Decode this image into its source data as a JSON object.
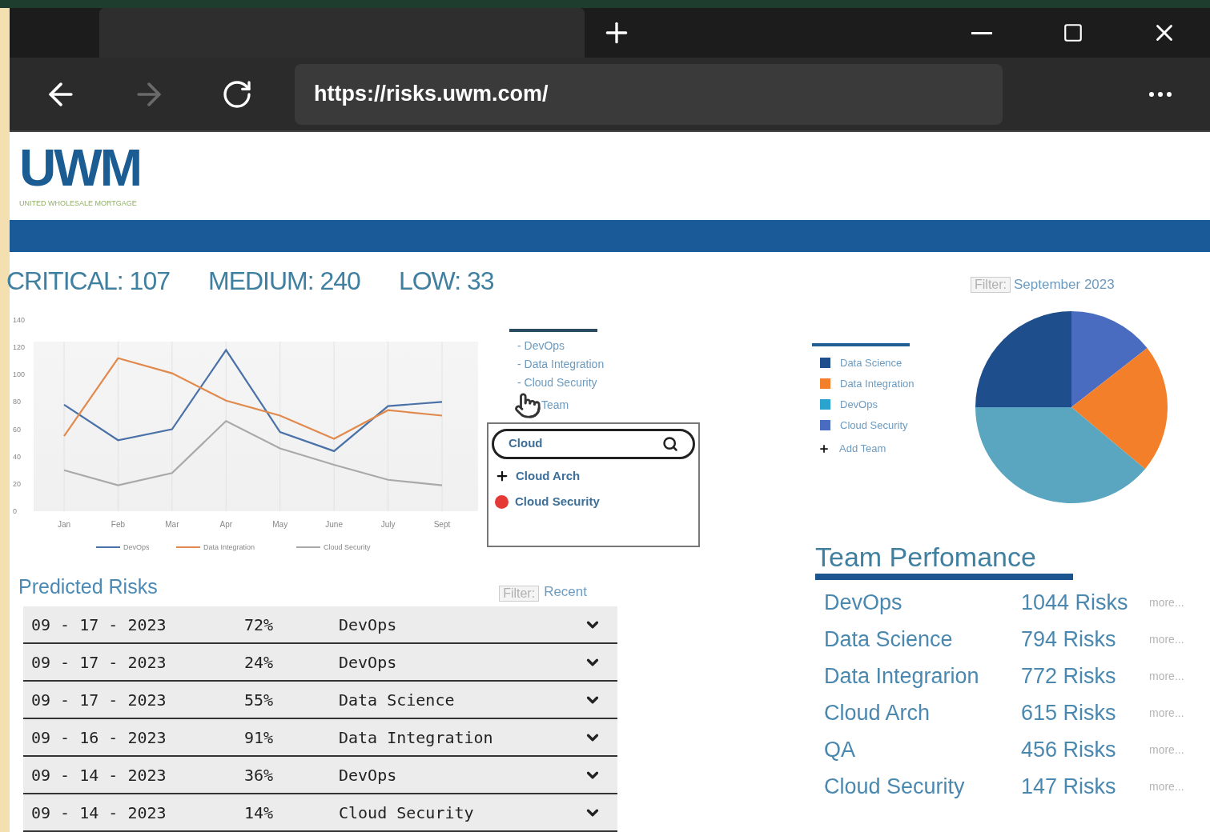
{
  "browser": {
    "url": "https://risks.uwm.com/",
    "back_disabled": false,
    "forward_disabled": true
  },
  "logo": {
    "mark": "UWM",
    "tagline": "UNITED WHOLESALE MORTGAGE"
  },
  "stats": [
    {
      "label": "CRITICAL: 107"
    },
    {
      "label": "MEDIUM: 240"
    },
    {
      "label": "LOW: 33"
    }
  ],
  "trend_chart": {
    "chart_data": {
      "type": "line",
      "grid": true,
      "legend": "bottom",
      "categories": [
        "Jan",
        "Feb",
        "Mar",
        "Apr",
        "May",
        "June",
        "July",
        "Sept"
      ],
      "ylim": [
        0,
        140
      ],
      "yticks": [
        0,
        20,
        40,
        60,
        80,
        100,
        120,
        140
      ],
      "series": [
        {
          "name": "DevOps",
          "color": "#4a72a8",
          "values": [
            78,
            52,
            60,
            118,
            58,
            44,
            77,
            80
          ]
        },
        {
          "name": "Data Integration",
          "color": "#e08a4e",
          "values": [
            55,
            112,
            101,
            81,
            70,
            53,
            74,
            70
          ]
        },
        {
          "name": "Cloud Security",
          "color": "#a9a9a9",
          "values": [
            30,
            19,
            28,
            66,
            46,
            34,
            23,
            19
          ]
        }
      ]
    }
  },
  "team_list": {
    "items": [
      "- DevOps",
      "- Data Integration",
      "- Cloud Security"
    ],
    "partial_item": "Team"
  },
  "team_search": {
    "value": "Cloud",
    "results": [
      {
        "kind": "add",
        "label": "Cloud Arch"
      },
      {
        "kind": "remove",
        "label": "Cloud Security"
      }
    ]
  },
  "pie_filter": {
    "button": "Filter:",
    "value": "September 2023"
  },
  "pie_legend": [
    {
      "label": "Data Science",
      "color": "#1f4e8c"
    },
    {
      "label": "Data Integration",
      "color": "#f47f2a"
    },
    {
      "label": "DevOps",
      "color": "#2aa3cf"
    },
    {
      "label": "Cloud Security",
      "color": "#4a6cc0"
    }
  ],
  "pie_add": "Add Team",
  "predicted_risks": {
    "title": "Predicted Risks",
    "filter_button": "Filter:",
    "filter_value": "Recent",
    "rows": [
      {
        "date": "09 - 17 - 2023",
        "percent": "72%",
        "team": "DevOps"
      },
      {
        "date": "09 - 17 - 2023",
        "percent": "24%",
        "team": "DevOps"
      },
      {
        "date": "09 - 17 - 2023",
        "percent": "55%",
        "team": "Data Science"
      },
      {
        "date": "09 - 16 - 2023",
        "percent": "91%",
        "team": "Data Integration"
      },
      {
        "date": "09 - 14 - 2023",
        "percent": "36%",
        "team": "DevOps"
      },
      {
        "date": "09 - 14 - 2023",
        "percent": "14%",
        "team": "Cloud Security"
      }
    ]
  },
  "team_performance": {
    "title": "Team Perfomance",
    "rows": [
      {
        "team": "DevOps",
        "risks": "1044 Risks",
        "link": "more..."
      },
      {
        "team": "Data Science",
        "risks": "794 Risks",
        "link": "more..."
      },
      {
        "team": "Data Integrarion",
        "risks": "772 Risks",
        "link": "more..."
      },
      {
        "team": "Cloud Arch",
        "risks": "615 Risks",
        "link": "more..."
      },
      {
        "team": "QA",
        "risks": "456 Risks",
        "link": "more..."
      },
      {
        "team": "Cloud Security",
        "risks": "147 Risks",
        "link": "more..."
      }
    ]
  }
}
